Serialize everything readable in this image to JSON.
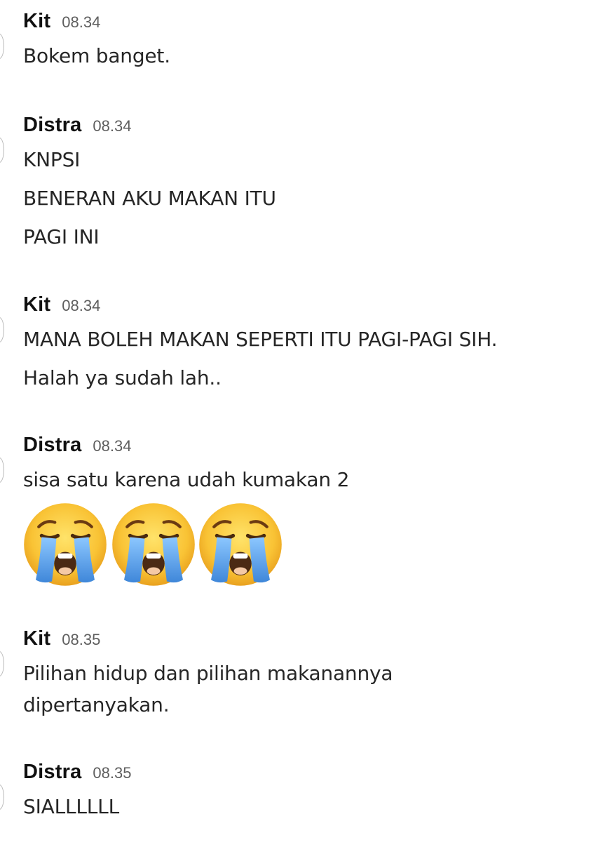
{
  "messages": [
    {
      "author": "Kit",
      "time": "08.34",
      "lines": [
        "Bokem banget."
      ]
    },
    {
      "author": "Distra",
      "time": "08.34",
      "lines": [
        "KNPSI",
        "BENERAN AKU MAKAN ITU",
        "PAGI INI"
      ]
    },
    {
      "author": "Kit",
      "time": "08.34",
      "lines": [
        "MANA BOLEH MAKAN SEPERTI ITU PAGI-PAGI SIH.",
        "Halah ya sudah lah.."
      ]
    },
    {
      "author": "Distra",
      "time": "08.34",
      "lines": [
        "sisa satu karena udah kumakan 2"
      ],
      "emojis": [
        "loudly-crying-face",
        "loudly-crying-face",
        "loudly-crying-face"
      ]
    },
    {
      "author": "Kit",
      "time": "08.35",
      "lines": [
        "Pilihan hidup dan pilihan makanannya",
        "dipertanyakan."
      ]
    },
    {
      "author": "Distra",
      "time": "08.35",
      "lines": [
        "SIALLLLLL"
      ]
    }
  ],
  "colors": {
    "background": "#ffffff",
    "author": "#111111",
    "timestamp": "#5e5e5e",
    "text": "#262626",
    "emoji_face": "#f7c237",
    "emoji_tears": "#5aa0e6"
  }
}
